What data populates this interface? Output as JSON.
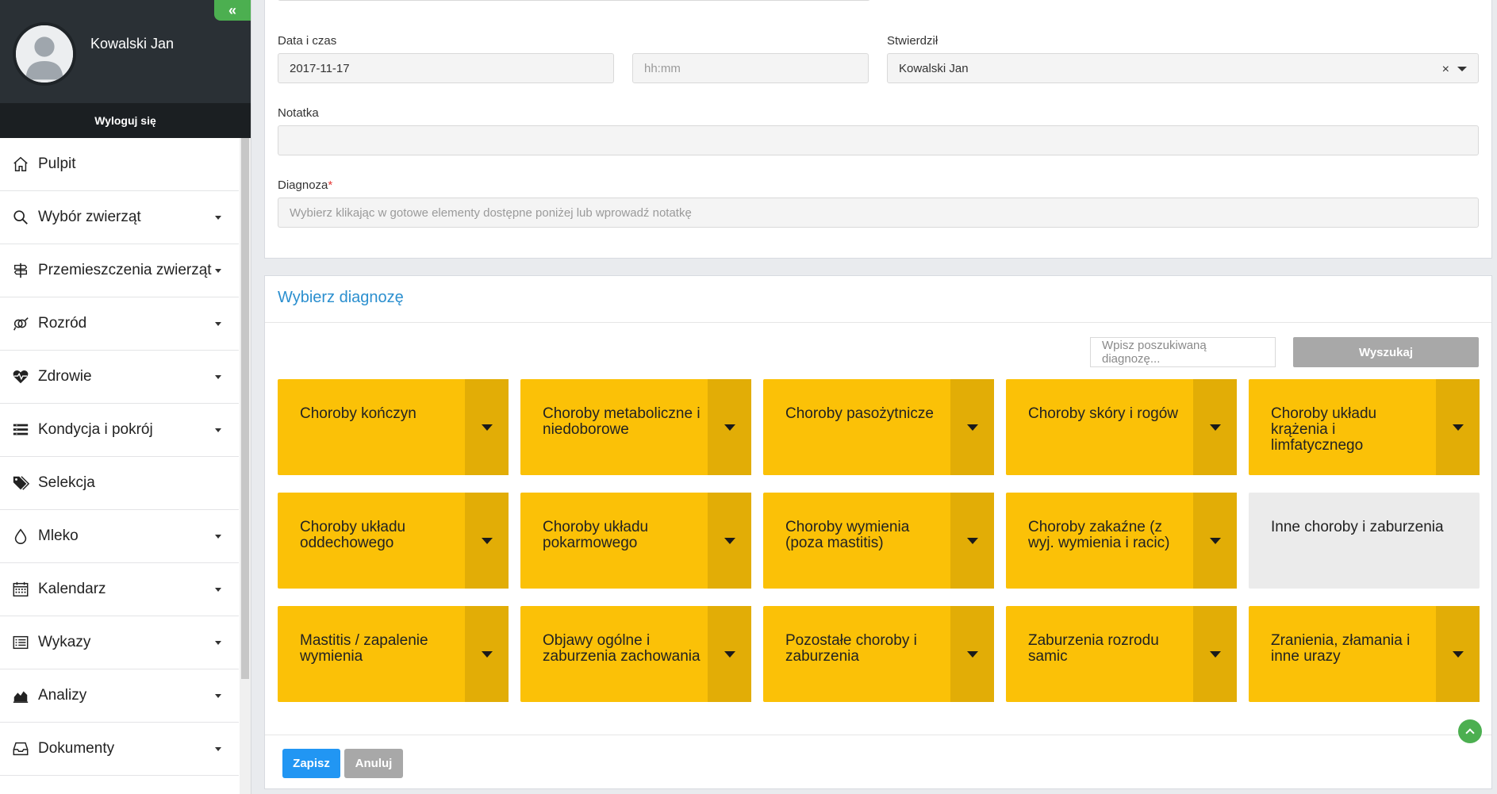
{
  "sidebar": {
    "user_name": "Kowalski Jan",
    "collapse_glyph": "«",
    "logout_label": "Wyloguj się",
    "items": [
      {
        "label": "Pulpit",
        "icon": "home-icon"
      },
      {
        "label": "Wybór zwierząt",
        "icon": "search-icon"
      },
      {
        "label": "Przemieszczenia zwierząt",
        "icon": "signpost-icon"
      },
      {
        "label": "Rozród",
        "icon": "gender-icon"
      },
      {
        "label": "Zdrowie",
        "icon": "heartbeat-icon"
      },
      {
        "label": "Kondycja i pokrój",
        "icon": "list-icon"
      },
      {
        "label": "Selekcja",
        "icon": "tags-icon"
      },
      {
        "label": "Mleko",
        "icon": "drop-icon"
      },
      {
        "label": "Kalendarz",
        "icon": "calendar-icon"
      },
      {
        "label": "Wykazy",
        "icon": "list-alt-icon"
      },
      {
        "label": "Analizy",
        "icon": "area-chart-icon"
      },
      {
        "label": "Dokumenty",
        "icon": "inbox-icon"
      }
    ]
  },
  "form": {
    "date_label": "Data i czas",
    "date_value": "2017-11-17",
    "time_placeholder": "hh:mm",
    "confirmed_label": "Stwierdził",
    "confirmed_value": "Kowalski Jan",
    "clear_glyph": "×",
    "note_label": "Notatka",
    "note_value": "",
    "diagnosis_label": "Diagnoza",
    "required_mark": "*",
    "diagnosis_placeholder": "Wybierz klikając w gotowe elementy dostępne poniżej lub wprowadź notatkę"
  },
  "diagnosis_panel": {
    "title": "Wybierz diagnozę",
    "search_placeholder": "Wpisz poszukiwaną diagnozę...",
    "search_button": "Wyszukaj",
    "tiles": [
      {
        "label": "Choroby kończyn",
        "has_dropdown": true,
        "color": "#fbc107"
      },
      {
        "label": "Choroby metaboliczne i niedoborowe",
        "has_dropdown": true,
        "color": "#fbc107"
      },
      {
        "label": "Choroby pasożytnicze",
        "has_dropdown": true,
        "color": "#fbc107"
      },
      {
        "label": "Choroby skóry i rogów",
        "has_dropdown": true,
        "color": "#fbc107"
      },
      {
        "label": "Choroby układu krążenia i limfatycznego",
        "has_dropdown": true,
        "color": "#fbc107"
      },
      {
        "label": "Choroby układu oddechowego",
        "has_dropdown": true,
        "color": "#fbc107"
      },
      {
        "label": "Choroby układu pokarmowego",
        "has_dropdown": true,
        "color": "#fbc107"
      },
      {
        "label": "Choroby wymienia (poza mastitis)",
        "has_dropdown": true,
        "color": "#fbc107"
      },
      {
        "label": "Choroby zakaźne (z wyj. wymienia i racic)",
        "has_dropdown": true,
        "color": "#fbc107"
      },
      {
        "label": "Inne choroby i zaburzenia",
        "has_dropdown": false,
        "color": "#ebebeb"
      },
      {
        "label": "Mastitis / zapalenie wymienia",
        "has_dropdown": true,
        "color": "#fbc107"
      },
      {
        "label": "Objawy ogólne i zaburzenia zachowania",
        "has_dropdown": true,
        "color": "#fbc107"
      },
      {
        "label": "Pozostałe choroby i zaburzenia",
        "has_dropdown": true,
        "color": "#fbc107"
      },
      {
        "label": "Zaburzenia rozrodu samic",
        "has_dropdown": true,
        "color": "#fbc107"
      },
      {
        "label": "Zranienia, złamania i inne urazy",
        "has_dropdown": true,
        "color": "#fbc107"
      }
    ],
    "save_label": "Zapisz",
    "cancel_label": "Anuluj"
  },
  "colors": {
    "accent_blue": "#2196f3",
    "title_blue": "#2b8fcf",
    "tile_yellow": "#fbc107",
    "tile_dropdown": "#e2ad06",
    "green": "#4caf50",
    "sidebar_dark": "#2a3035"
  }
}
